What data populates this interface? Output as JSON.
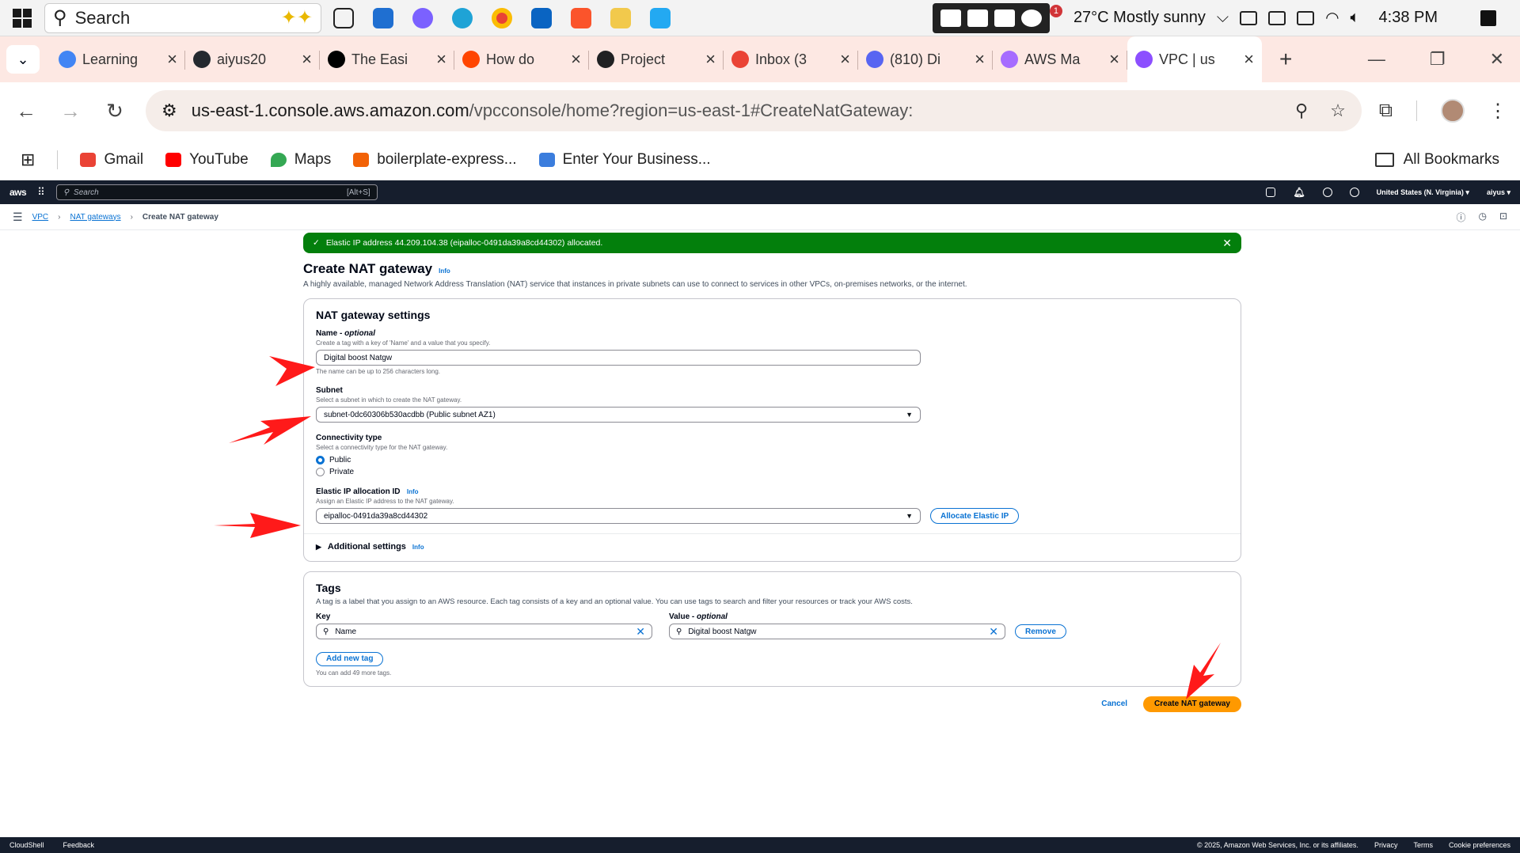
{
  "taskbar": {
    "search_placeholder": "Search",
    "weather": "27°C  Mostly sunny",
    "time": "4:38 PM",
    "notification_badge": "1",
    "apps": [
      "task-view",
      "microsoft-store",
      "copilot",
      "edge",
      "chrome",
      "outlook",
      "brave",
      "file-explorer",
      "vscode"
    ]
  },
  "tabs": [
    {
      "title": "Learning",
      "fav": "#4285f4"
    },
    {
      "title": "aiyus20",
      "fav": "#24292f"
    },
    {
      "title": "The Easi",
      "fav": "#000000"
    },
    {
      "title": "How do",
      "fav": "#ff4500"
    },
    {
      "title": "Project",
      "fav": "#202123"
    },
    {
      "title": "Inbox (3",
      "fav": "#ea4335"
    },
    {
      "title": "(810) Di",
      "fav": "#5865f2"
    },
    {
      "title": "AWS Ma",
      "fav": "#a66cff"
    },
    {
      "title": "VPC | us",
      "fav": "#8c4fff",
      "active": true
    }
  ],
  "address": {
    "host": "us-east-1.console.aws.amazon.com",
    "path": "/vpcconsole/home?region=us-east-1#CreateNatGateway:"
  },
  "bookmarks": {
    "items": [
      "Gmail",
      "YouTube",
      "Maps",
      "boilerplate-express...",
      "Enter Your Business..."
    ],
    "all": "All Bookmarks"
  },
  "aws": {
    "logo": "aws",
    "search_placeholder": "Search",
    "search_kbd": "[Alt+S]",
    "region": "United States (N. Virginia) ▾",
    "user": "aiyus ▾"
  },
  "breadcrumb": {
    "vpc": "VPC",
    "nat": "NAT gateways",
    "current": "Create NAT gateway"
  },
  "flash": {
    "message": "Elastic IP address 44.209.104.38 (eipalloc-0491da39a8cd44302) allocated."
  },
  "page": {
    "title": "Create NAT gateway",
    "info": "Info",
    "description": "A highly available, managed Network Address Translation (NAT) service that instances in private subnets can use to connect to services in other VPCs, on-premises networks, or the internet."
  },
  "settings": {
    "heading": "NAT gateway settings",
    "name_label": "Name",
    "name_optional": "optional",
    "name_desc": "Create a tag with a key of 'Name' and a value that you specify.",
    "name_value": "Digital boost Natgw",
    "name_constraint": "The name can be up to 256 characters long.",
    "subnet_label": "Subnet",
    "subnet_desc": "Select a subnet in which to create the NAT gateway.",
    "subnet_value": "subnet-0dc60306b530acdbb (Public subnet AZ1)",
    "conn_label": "Connectivity type",
    "conn_desc": "Select a connectivity type for the NAT gateway.",
    "conn_public": "Public",
    "conn_private": "Private",
    "eip_label": "Elastic IP allocation ID",
    "eip_info": "Info",
    "eip_desc": "Assign an Elastic IP address to the NAT gateway.",
    "eip_value": "eipalloc-0491da39a8cd44302",
    "allocate_btn": "Allocate Elastic IP",
    "additional": "Additional settings",
    "additional_info": "Info"
  },
  "tags": {
    "heading": "Tags",
    "desc": "A tag is a label that you assign to an AWS resource. Each tag consists of a key and an optional value. You can use tags to search and filter your resources or track your AWS costs.",
    "key_label": "Key",
    "value_label": "Value",
    "value_optional": "optional",
    "key_value": "Name",
    "value_value": "Digital boost Natgw",
    "remove_btn": "Remove",
    "add_btn": "Add new tag",
    "limit": "You can add 49 more tags."
  },
  "actions": {
    "cancel": "Cancel",
    "create": "Create NAT gateway"
  },
  "footer": {
    "cloudshell": "CloudShell",
    "feedback": "Feedback",
    "copyright": "© 2025, Amazon Web Services, Inc. or its affiliates.",
    "privacy": "Privacy",
    "terms": "Terms",
    "cookies": "Cookie preferences"
  },
  "colors": {
    "flash_green": "#037f0c",
    "aws_link": "#0972d3",
    "aws_primary": "#ff9900",
    "aws_nav": "#161e2d",
    "annotation_arrow": "#ff1a1a"
  }
}
